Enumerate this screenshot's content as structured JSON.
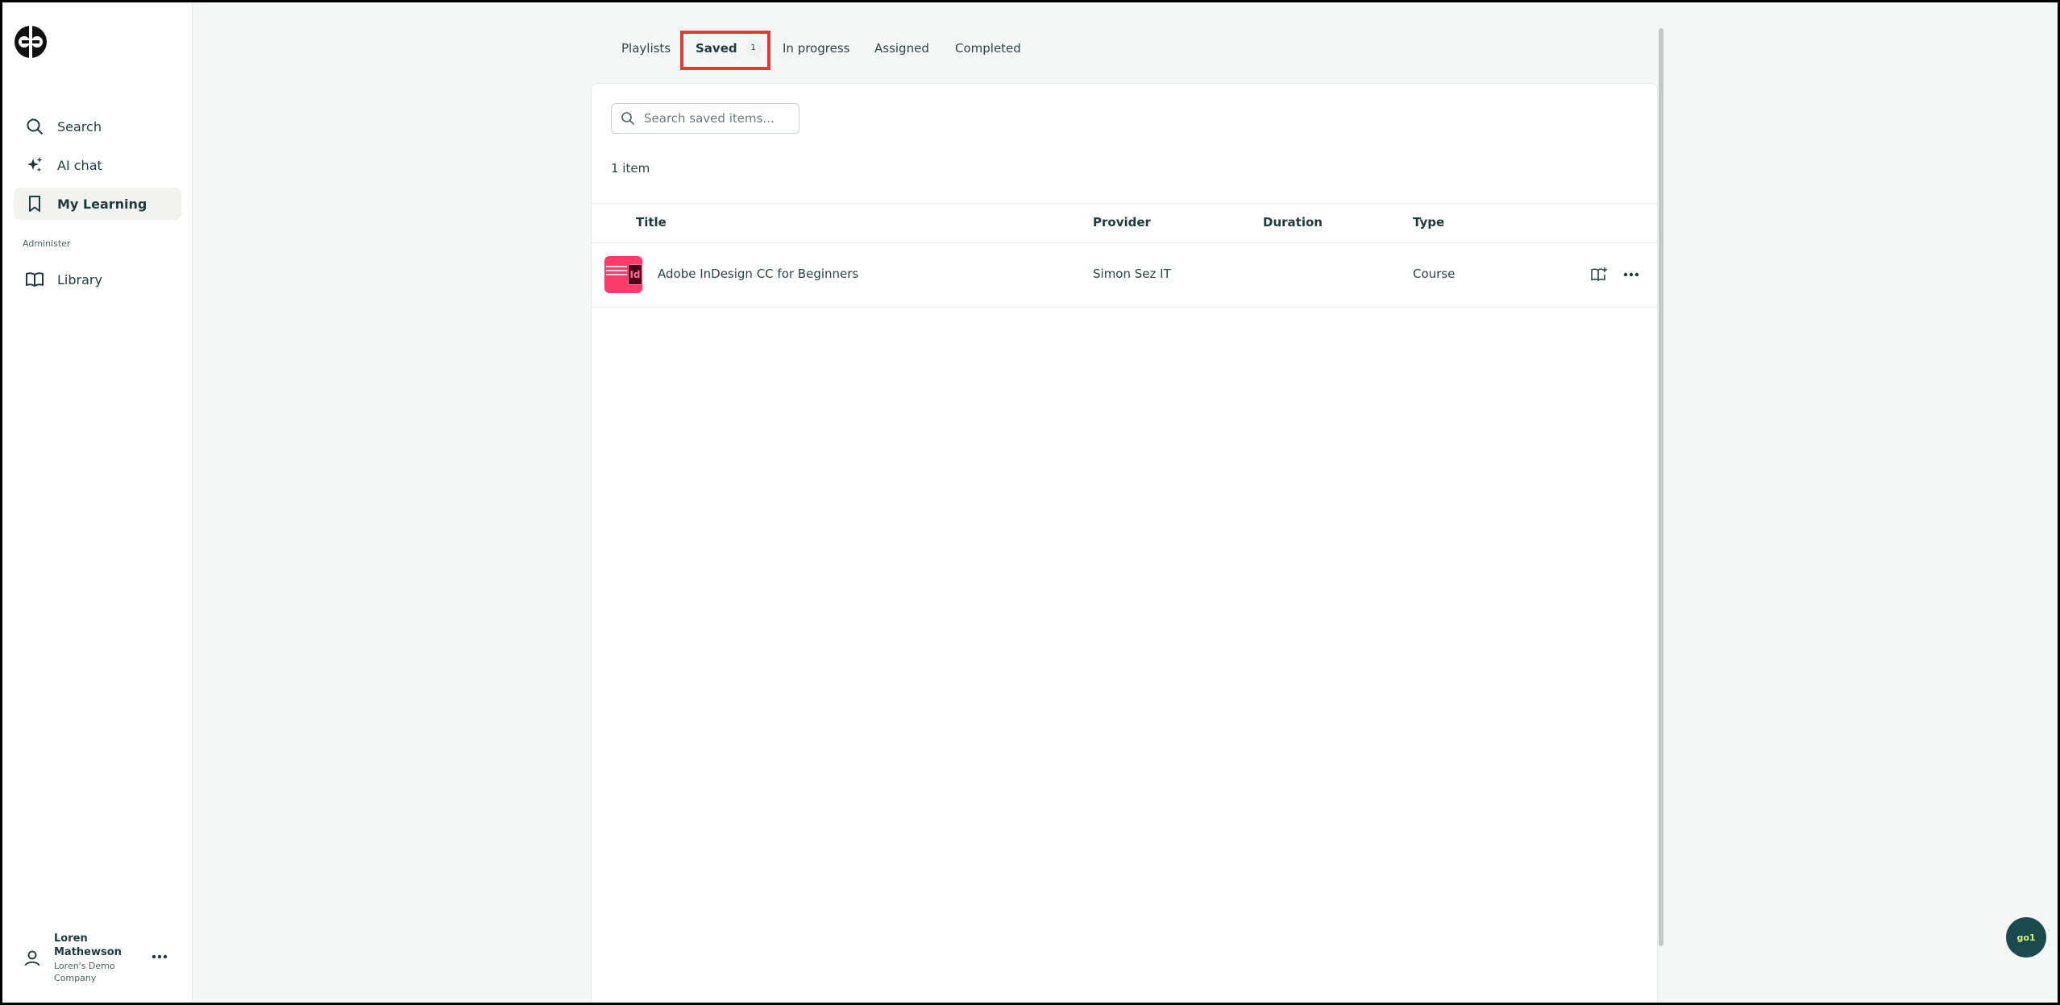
{
  "sidebar": {
    "nav": [
      {
        "label": "Search",
        "icon": "search-icon"
      },
      {
        "label": "AI chat",
        "icon": "sparkle-icon"
      },
      {
        "label": "My Learning",
        "icon": "bookmark-icon",
        "active": true
      }
    ],
    "section_label": "Administer",
    "admin_nav": [
      {
        "label": "Library",
        "icon": "book-icon"
      }
    ],
    "user": {
      "name": "Loren Mathewson",
      "org": "Loren's Demo Company"
    }
  },
  "tabs": [
    {
      "label": "Playlists"
    },
    {
      "label": "Saved",
      "badge": "1",
      "active": true
    },
    {
      "label": "In progress"
    },
    {
      "label": "Assigned"
    },
    {
      "label": "Completed"
    }
  ],
  "search": {
    "placeholder": "Search saved items...",
    "value": ""
  },
  "count_text": "1 item",
  "table": {
    "columns": [
      "Title",
      "Provider",
      "Duration",
      "Type"
    ],
    "rows": [
      {
        "title": "Adobe InDesign CC for Beginners",
        "provider": "Simon Sez IT",
        "duration": "",
        "type": "Course",
        "thumb_mark": "Id"
      }
    ]
  },
  "chat_button": {
    "label": "go1"
  },
  "colors": {
    "accent": "#1f3a3d",
    "highlight": "#e53935",
    "thumb": "#ff3b6b",
    "chat": "#1a4a4d"
  }
}
